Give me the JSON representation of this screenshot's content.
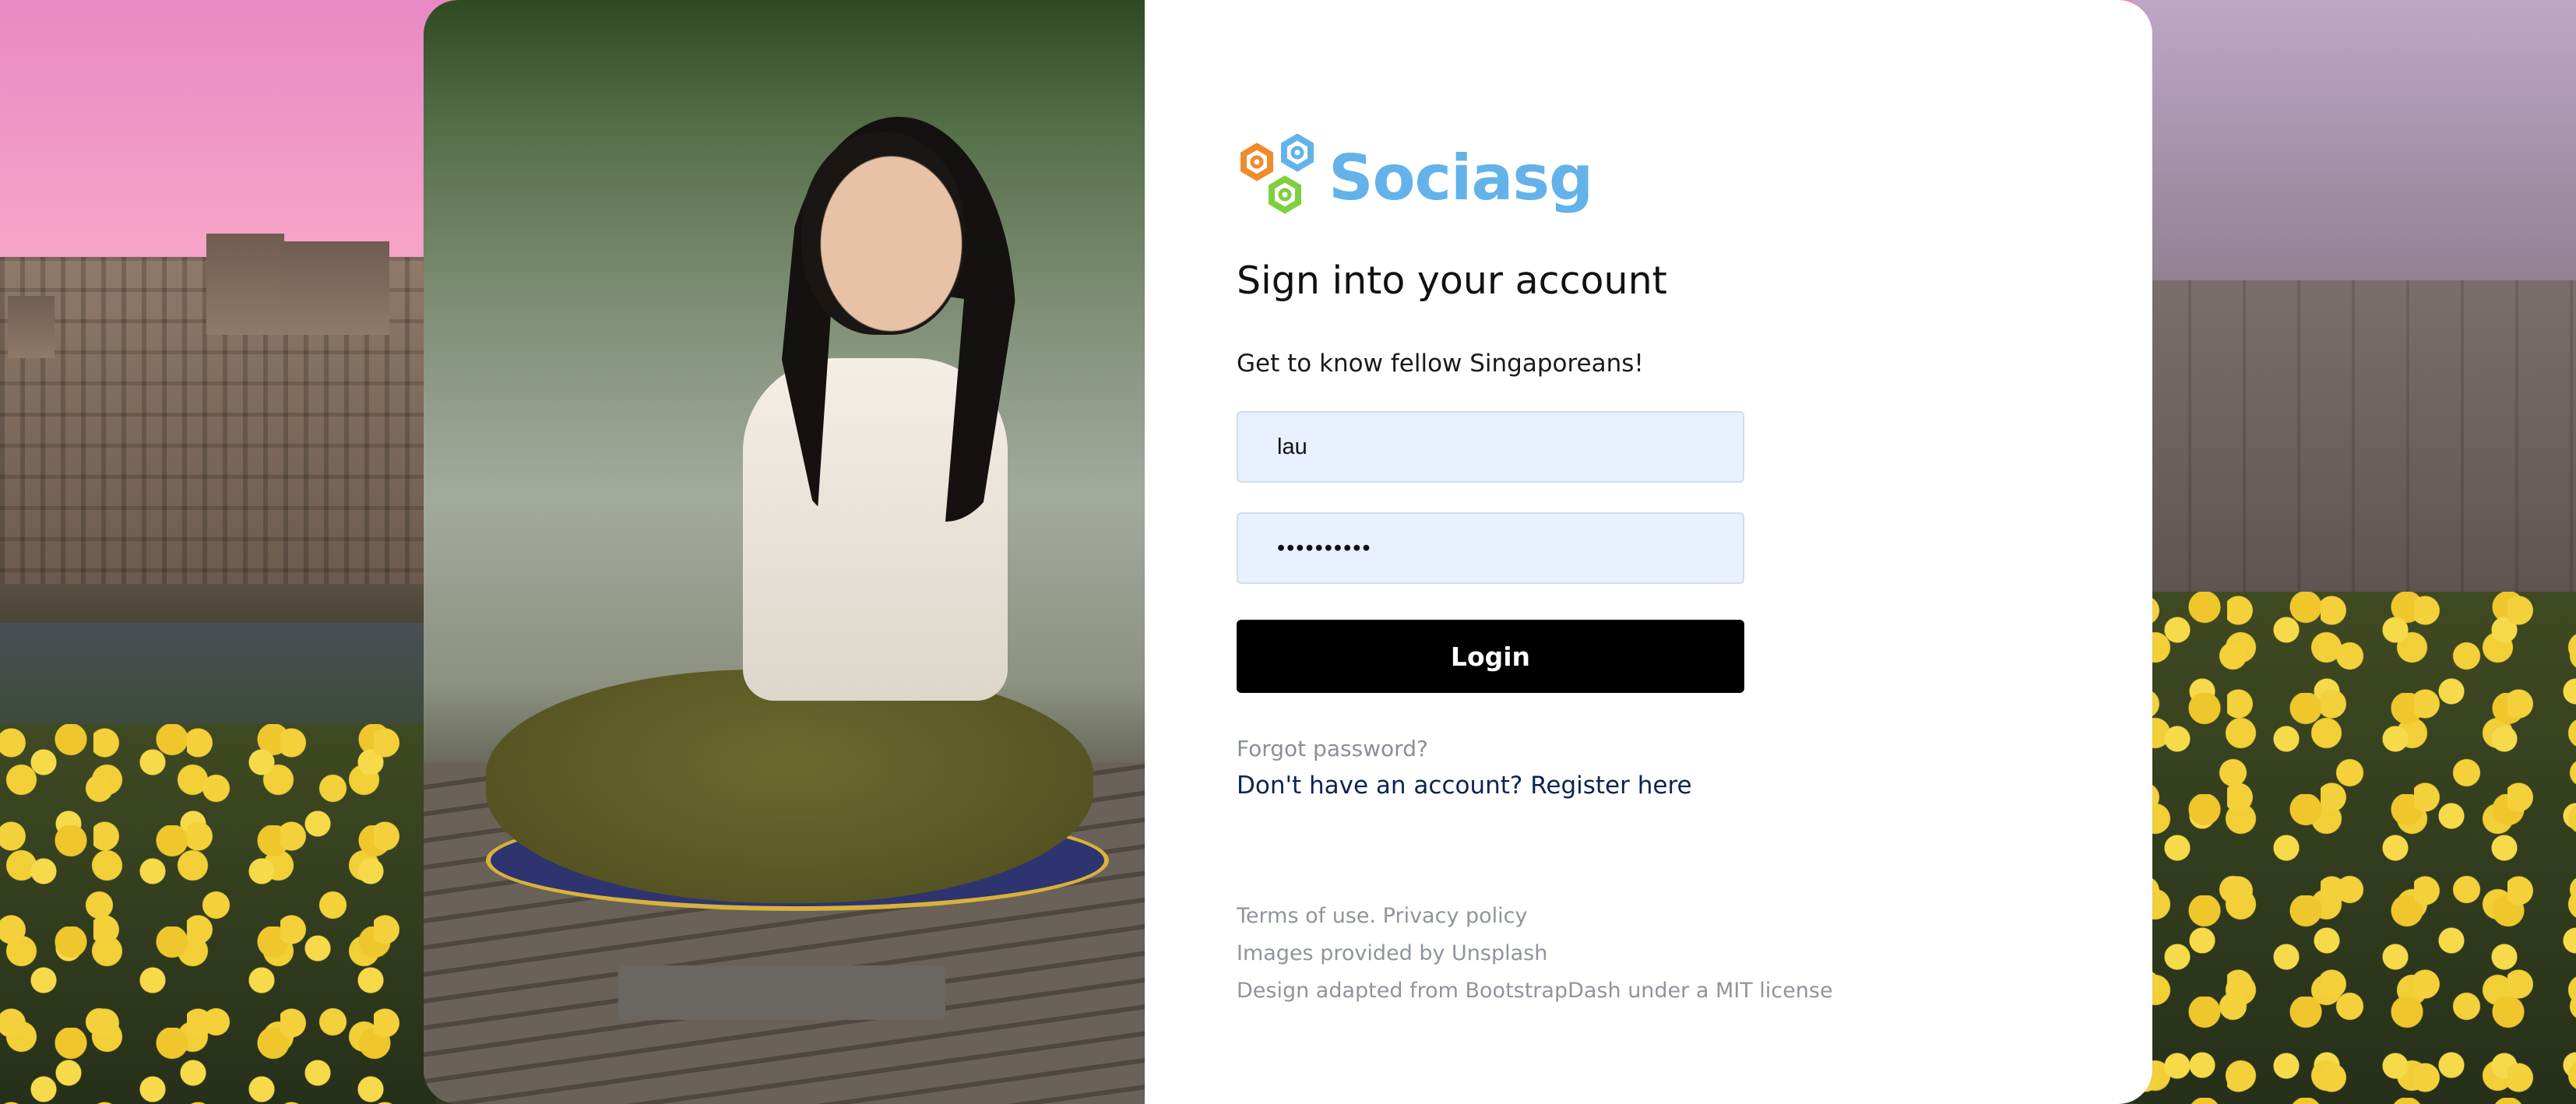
{
  "brand": {
    "name": "Sociasg",
    "logo_icon": "hexagon-cluster-logo",
    "logo_colors": [
      "#f08a2c",
      "#63b3ea",
      "#7fcf3f"
    ],
    "name_color": "#63b3ea"
  },
  "form": {
    "title": "Sign into your account",
    "subtitle": "Get to know fellow Singaporeans!",
    "username_value": "lau",
    "password_value": "••••••••••",
    "login_label": "Login",
    "forgot_label": "Forgot password?",
    "register_label": "Don't have an account? Register here"
  },
  "footer": {
    "terms_label": "Terms of use.",
    "privacy_label": "Privacy policy",
    "images_credit": "Images provided by Unsplash",
    "design_credit": "Design adapted from BootstrapDash under a MIT license"
  },
  "colors": {
    "button_bg": "#000000",
    "input_bg": "#e8f0fe",
    "register_link": "#0d2352",
    "muted_text": "#8f949c"
  }
}
